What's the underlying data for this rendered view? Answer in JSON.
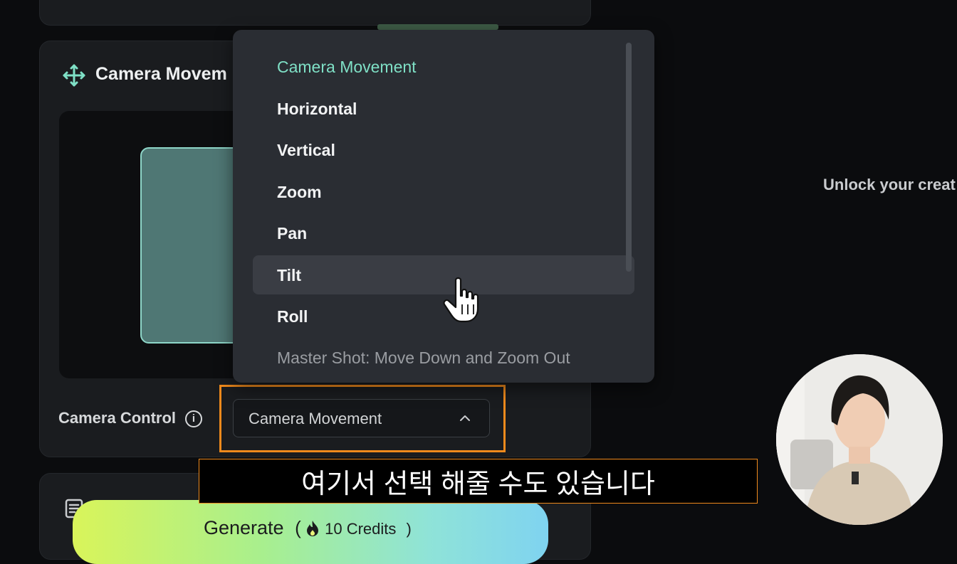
{
  "camera_section": {
    "title": "Camera Movem",
    "control_label": "Camera Control",
    "info_icon": "info-icon",
    "select_value": "Camera Movement"
  },
  "dropdown": {
    "options": [
      {
        "label": "Camera Movement",
        "state": "selected"
      },
      {
        "label": "Horizontal",
        "state": "normal"
      },
      {
        "label": "Vertical",
        "state": "normal"
      },
      {
        "label": "Zoom",
        "state": "normal"
      },
      {
        "label": "Pan",
        "state": "normal"
      },
      {
        "label": "Tilt",
        "state": "hover"
      },
      {
        "label": "Roll",
        "state": "normal"
      },
      {
        "label": "Master Shot: Move Down and Zoom Out",
        "state": "partial"
      }
    ]
  },
  "generate": {
    "label": "Generate",
    "open_paren": "(",
    "credits": "10 Credits",
    "close_paren": ")"
  },
  "side_text": "Unlock your creat",
  "subtitle": "여기서 선택 해줄 수도 있습니다",
  "colors": {
    "accent": "#7fe0c6",
    "highlight_border": "#f08a1c",
    "panel_bg": "#1a1c1f",
    "dropdown_bg": "#2a2d33"
  }
}
